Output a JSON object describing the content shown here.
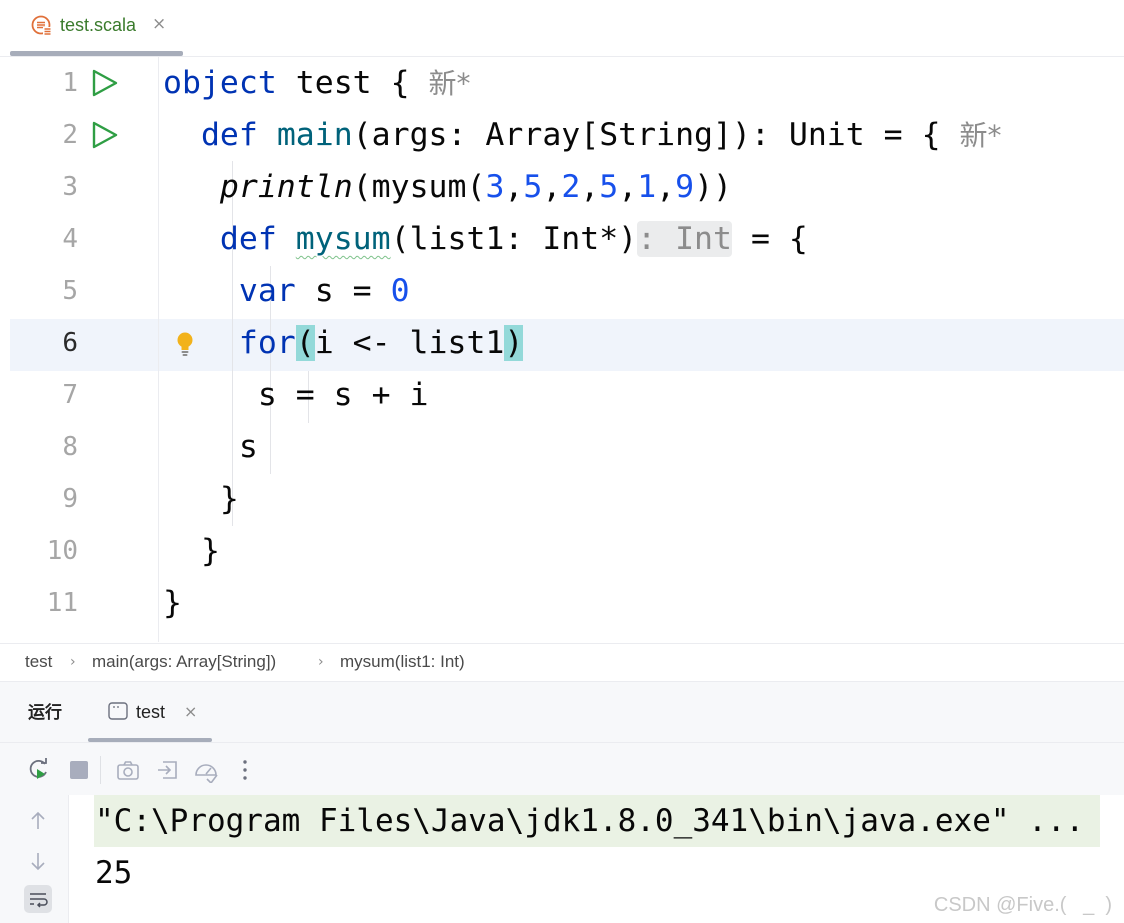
{
  "file_tab": {
    "name": "test.scala",
    "close": "×"
  },
  "editor": {
    "new_mark": "新*",
    "lines": [
      {
        "n": "1",
        "code": [
          [
            "kw",
            "object"
          ],
          [
            "",
            "test"
          ],
          [
            "",
            "{"
          ]
        ]
      },
      {
        "n": "2",
        "code": [
          [
            "kw",
            "def"
          ],
          [
            "fn",
            "main"
          ],
          [
            "",
            "(args: Array[String]): Unit = {"
          ]
        ]
      },
      {
        "n": "3",
        "code": [
          [
            "it",
            "println"
          ],
          [
            "",
            "(mysum("
          ],
          [
            "num",
            "3"
          ],
          [
            "",
            ","
          ],
          [
            "num",
            "5"
          ],
          [
            "",
            ","
          ],
          [
            "num",
            "2"
          ],
          [
            "",
            ","
          ],
          [
            "num",
            "5"
          ],
          [
            "",
            ","
          ],
          [
            "num",
            "1"
          ],
          [
            "",
            ","
          ],
          [
            "num",
            "9"
          ],
          [
            "",
            "))"
          ]
        ]
      },
      {
        "n": "4",
        "code": [
          [
            "kw",
            "def"
          ],
          [
            "fn",
            "mysum"
          ],
          [
            "",
            "(list1: Int*)"
          ],
          [
            "hint",
            ": Int"
          ],
          [
            "",
            "= {"
          ]
        ]
      },
      {
        "n": "5",
        "code": [
          [
            "kw",
            "var"
          ],
          [
            "",
            "s ="
          ],
          [
            "num",
            "0"
          ]
        ]
      },
      {
        "n": "6",
        "code": [
          [
            "kw",
            "for"
          ],
          [
            "brk",
            "("
          ],
          [
            "",
            "i <- list1"
          ],
          [
            "brk",
            ")"
          ]
        ]
      },
      {
        "n": "7",
        "code": [
          [
            "",
            "s = s + i"
          ]
        ]
      },
      {
        "n": "8",
        "code": [
          [
            "",
            "s"
          ]
        ]
      },
      {
        "n": "9",
        "code": [
          [
            "",
            "}"
          ]
        ]
      },
      {
        "n": "10",
        "code": [
          [
            "",
            "}"
          ]
        ]
      },
      {
        "n": "11",
        "code": [
          [
            "",
            "}"
          ]
        ]
      }
    ]
  },
  "breadcrumb": {
    "items": [
      "test",
      "main(args: Array[String])",
      "mysum(list1: Int)"
    ],
    "separator": "›"
  },
  "run_panel": {
    "title": "运行",
    "tab": {
      "label": "test",
      "close": "×"
    },
    "console": {
      "command": "\"C:\\Program Files\\Java\\jdk1.8.0_341\\bin\\java.exe\" ...",
      "output": "25"
    }
  },
  "watermark": "CSDN @Five.(   _  )",
  "colors": {
    "keyword": "#0033b3",
    "function": "#00627a",
    "number": "#1750eb",
    "tab_label": "#3a7b2c",
    "run_gutter": "#2f9e44",
    "bulb": "#f2b21b"
  }
}
